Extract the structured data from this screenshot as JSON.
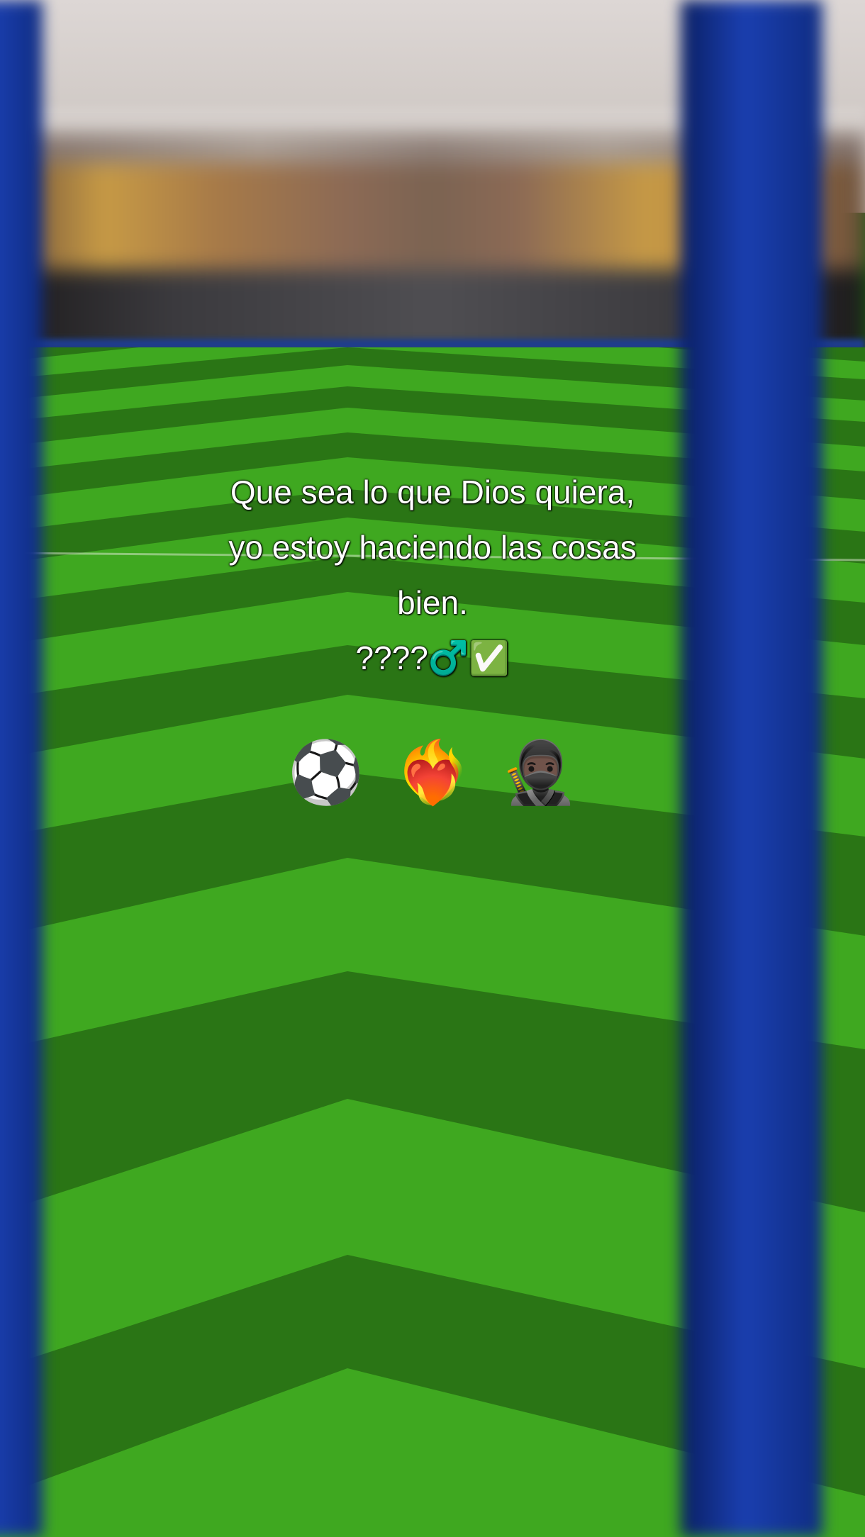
{
  "caption": {
    "line1": "Que sea lo que Dios quiera,",
    "line2": "yo estoy haciendo las cosas",
    "line3": "bien.",
    "line4": "????♂️✅"
  },
  "emojis": {
    "ball": "⚽",
    "heart_fire": "❤️‍🔥",
    "ninja": "🥷🏿"
  },
  "colors": {
    "grass_light": "#3fa820",
    "grass_dark": "#1e5a14",
    "post_blue": "#1a3fb0"
  }
}
